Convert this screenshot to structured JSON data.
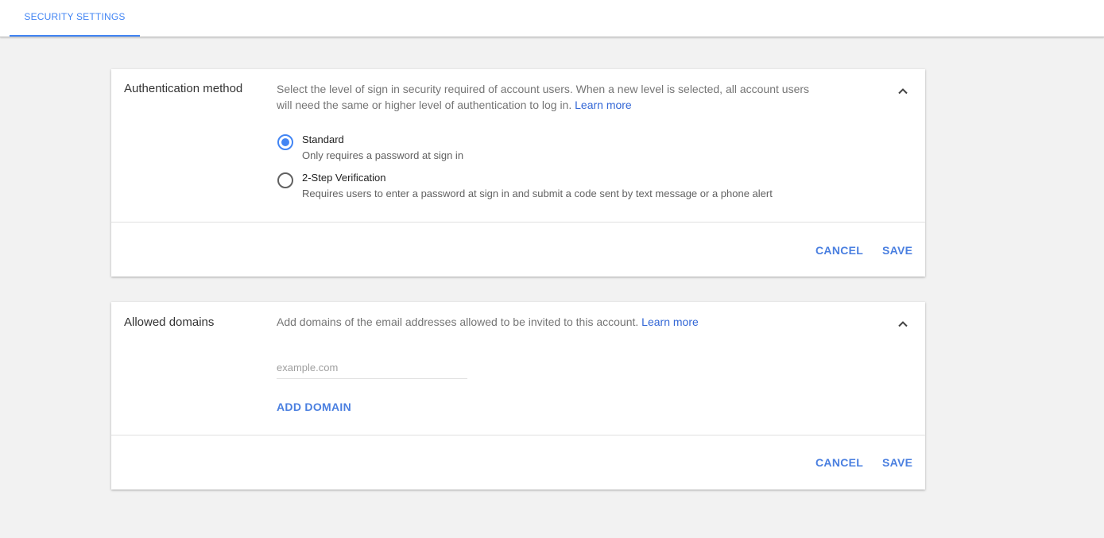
{
  "header": {
    "tab_label": "SECURITY SETTINGS"
  },
  "auth": {
    "title": "Authentication method",
    "description": "Select the level of sign in security required of account users. When a new level is selected, all account users will need the same or higher level of authentication to log in.",
    "learn_more": "Learn more",
    "options": [
      {
        "label": "Standard",
        "sublabel": "Only requires a password at sign in",
        "selected": true
      },
      {
        "label": "2-Step Verification",
        "sublabel": "Requires users to enter a password at sign in and submit a code sent by text message or a phone alert",
        "selected": false
      }
    ],
    "cancel_label": "CANCEL",
    "save_label": "SAVE",
    "collapse_icon": "chevron-up-icon"
  },
  "domains": {
    "title": "Allowed domains",
    "description": "Add domains of the email addresses allowed to be invited to this account.",
    "learn_more": "Learn more",
    "input_placeholder": "example.com",
    "input_value": "",
    "add_domain_label": "ADD DOMAIN",
    "cancel_label": "CANCEL",
    "save_label": "SAVE",
    "collapse_icon": "chevron-up-icon"
  },
  "colors": {
    "accent": "#4285f4",
    "link": "#3367d6",
    "background": "#f2f2f2"
  }
}
